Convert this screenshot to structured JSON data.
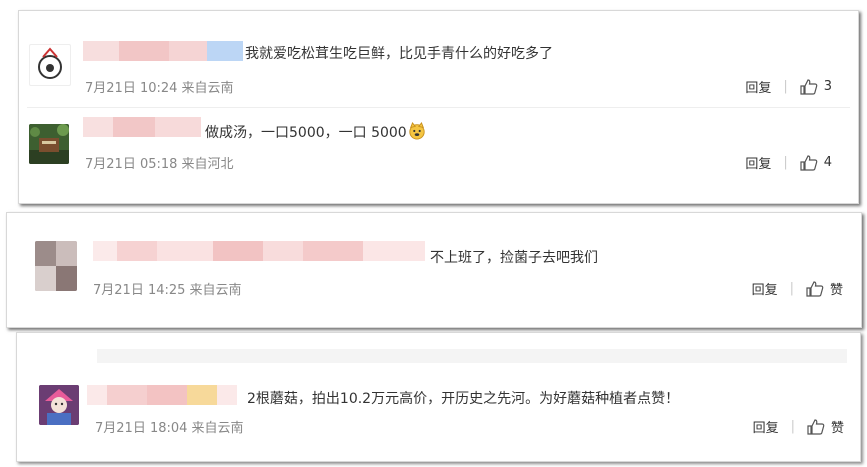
{
  "comments": [
    {
      "text": "我就爱吃松茸生吃巨鲜，比见手青什么的好吃多了",
      "meta": "7月21日 10:24 来自云南",
      "reply_label": "回复",
      "like_label": "3"
    },
    {
      "text": "做成汤，一口5000，一口 5000",
      "emoji": "dog-face-emoji",
      "meta": "7月21日 05:18 来自河北",
      "reply_label": "回复",
      "like_label": "4"
    },
    {
      "text": "不上班了，捡菌子去吧我们",
      "meta": "7月21日 14:25 来自云南",
      "reply_label": "回复",
      "like_label": "赞"
    },
    {
      "text": "2根蘑菇，拍出10.2万元高价，开历史之先河。为好蘑菇种植者点赞！",
      "meta": "7月21日 18:04 来自云南",
      "reply_label": "回复",
      "like_label": "赞"
    }
  ],
  "colors": {
    "separator": "#cccccc",
    "meta_text": "#888888",
    "blur_pink": "#f5c9c9",
    "blur_blue": "#bcd6f5",
    "blur_yellow": "#f7d99a"
  }
}
